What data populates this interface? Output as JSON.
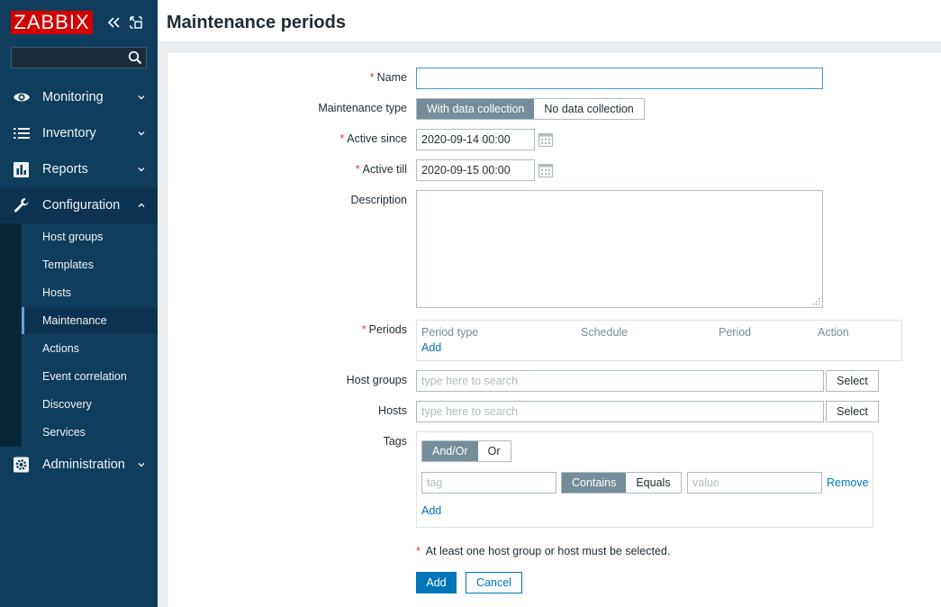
{
  "app": {
    "logo_text": "ZABBIX"
  },
  "sidebar": {
    "search": {
      "value": "",
      "placeholder": ""
    },
    "menu": [
      {
        "label": "Monitoring",
        "icon": "eye-icon"
      },
      {
        "label": "Inventory",
        "icon": "list-icon"
      },
      {
        "label": "Reports",
        "icon": "bar-chart-icon"
      },
      {
        "label": "Configuration",
        "icon": "wrench-icon",
        "expanded": true
      },
      {
        "label": "Administration",
        "icon": "gear-icon"
      }
    ],
    "configuration_items": [
      {
        "label": "Host groups"
      },
      {
        "label": "Templates"
      },
      {
        "label": "Hosts"
      },
      {
        "label": "Maintenance",
        "selected": true
      },
      {
        "label": "Actions"
      },
      {
        "label": "Event correlation"
      },
      {
        "label": "Discovery"
      },
      {
        "label": "Services"
      }
    ]
  },
  "header": {
    "title": "Maintenance periods"
  },
  "form": {
    "name": {
      "label": "Name",
      "value": ""
    },
    "maintenance_type": {
      "label": "Maintenance type",
      "options": [
        "With data collection",
        "No data collection"
      ],
      "selected": "With data collection"
    },
    "active_since": {
      "label": "Active since",
      "value": "2020-09-14 00:00"
    },
    "active_till": {
      "label": "Active till",
      "value": "2020-09-15 00:00"
    },
    "description": {
      "label": "Description",
      "value": ""
    },
    "periods": {
      "label": "Periods",
      "columns": [
        "Period type",
        "Schedule",
        "Period",
        "Action"
      ],
      "add_label": "Add"
    },
    "host_groups": {
      "label": "Host groups",
      "placeholder": "type here to search",
      "select_label": "Select"
    },
    "hosts": {
      "label": "Hosts",
      "placeholder": "type here to search",
      "select_label": "Select"
    },
    "tags": {
      "label": "Tags",
      "evaltype_options": [
        "And/Or",
        "Or"
      ],
      "evaltype_selected": "And/Or",
      "row": {
        "tag_placeholder": "tag",
        "operator_options": [
          "Contains",
          "Equals"
        ],
        "operator_selected": "Contains",
        "value_placeholder": "value",
        "remove_label": "Remove"
      },
      "add_label": "Add"
    },
    "note": "At least one host group or host must be selected.",
    "submit_label": "Add",
    "cancel_label": "Cancel"
  },
  "colors": {
    "sidebar_bg": "#0e3e5c",
    "logo_bg": "#d40000",
    "accent": "#0275b8",
    "required": "#e33734",
    "segment_on": "#768d99"
  }
}
